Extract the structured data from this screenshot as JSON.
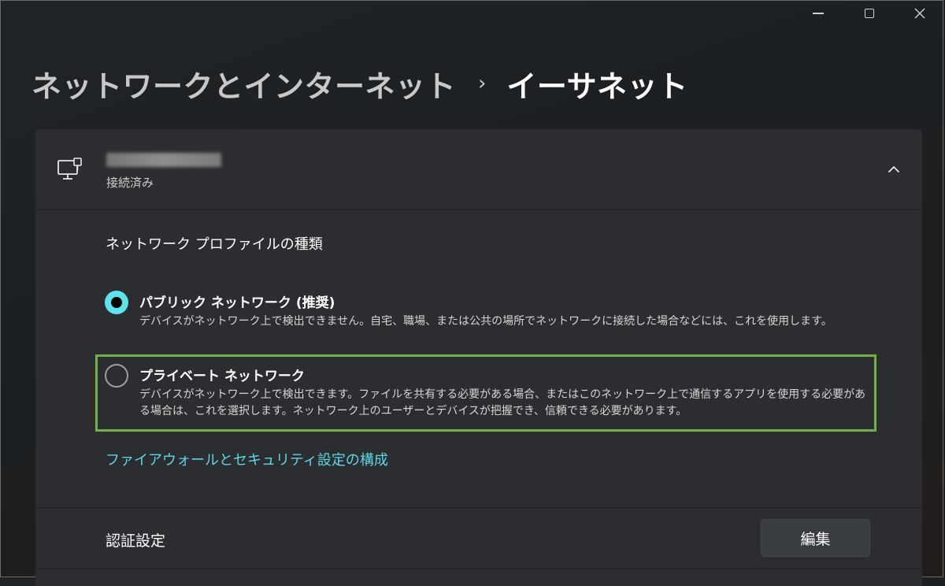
{
  "window": {
    "minimize_icon": "minimize-icon",
    "maximize_icon": "maximize-icon",
    "close_icon": "close-icon"
  },
  "breadcrumb": {
    "parent": "ネットワークとインターネット",
    "separator": "›",
    "current": "イーサネット"
  },
  "connection": {
    "icon": "ethernet-monitor-icon",
    "status": "接続済み",
    "expanded": true
  },
  "profile": {
    "title": "ネットワーク プロファイルの種類",
    "options": [
      {
        "label": "パブリック ネットワーク (推奨)",
        "description": "デバイスがネットワーク上で検出できません。自宅、職場、または公共の場所でネットワークに接続した場合などには、これを使用します。",
        "selected": true
      },
      {
        "label": "プライベート ネットワーク",
        "description": "デバイスがネットワーク上で検出できます。ファイルを共有する必要がある場合、またはこのネットワーク上で通信するアプリを使用する必要がある場合は、これを選択します。ネットワーク上のユーザーとデバイスが把握でき、信頼できる必要があります。",
        "selected": false
      }
    ],
    "firewall_link": "ファイアウォールとセキュリティ設定の構成"
  },
  "auth": {
    "label": "認証設定",
    "edit_button": "編集"
  },
  "colors": {
    "accent": "#5ee3ec",
    "link": "#5fd6e6",
    "highlight_box": "#71b04c",
    "card": "#2b2d30"
  }
}
